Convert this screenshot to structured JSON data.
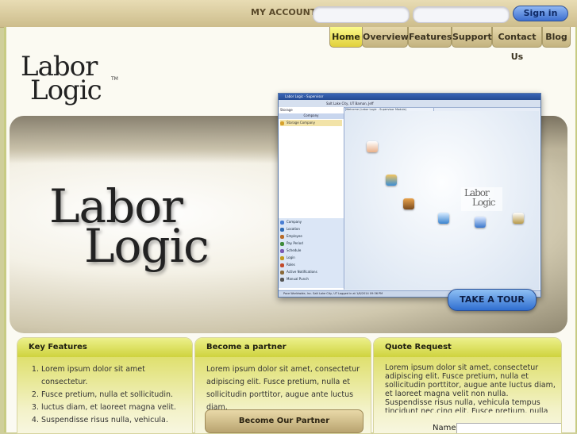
{
  "header": {
    "account_label": "MY ACCOUNT",
    "username_placeholder": "",
    "password_placeholder": "",
    "signin_label": "Sign in"
  },
  "nav": {
    "tabs": [
      {
        "label": "Home",
        "active": true
      },
      {
        "label": "Overview"
      },
      {
        "label": "Features"
      },
      {
        "label": "Support"
      },
      {
        "label": "Contact Us"
      },
      {
        "label": "Blog"
      }
    ]
  },
  "logo": {
    "line1": "Labor",
    "line2": "Logic",
    "trademark": "TM"
  },
  "hero": {
    "logo_line1": "Labor",
    "logo_line2": "Logic",
    "app_screenshot": {
      "title": "Labor Logic - Supervisor",
      "toolbar_text": "Salt Lake City, UT   Baman, Jeff",
      "left_header": "Storage",
      "company_header": "Company",
      "company_item": "Storage Company",
      "tab_text": "Welcome (Labor Logic - Supervisor Module)",
      "left_menu": [
        "Company",
        "Location",
        "Employee",
        "Pay Period",
        "Schedule",
        "Login",
        "Roles",
        "Active Notifications",
        "Manual Punch"
      ],
      "status_text": "Pace Worldwide, Inc.   Salt Lake City, UT   Logged in at 1/6/2014 09:36 PM",
      "canvas_logo_line1": "Labor",
      "canvas_logo_line2": "Logic"
    },
    "tour_label": "TAKE A TOUR"
  },
  "panels": {
    "key_features": {
      "title": "Key Features",
      "items": [
        "Lorem ipsum dolor sit amet consectetur.",
        "Fusce pretium, nulla et sollicitudin.",
        "luctus diam, et laoreet magna velit.",
        "Suspendisse risus nulla, vehicula."
      ]
    },
    "partner": {
      "title": "Become a partner",
      "text": "Lorem ipsum dolor sit amet, consectetur adipiscing elit. Fusce pretium, nulla et sollicitudin porttitor, augue ante luctus diam.",
      "button_label": "Become Our Partner"
    },
    "quote": {
      "title": "Quote Request",
      "text": "Lorem ipsum dolor sit amet, consectetur adipiscing elit. Fusce pretium, nulla et sollicitudin porttitor, augue ante luctus diam, et laoreet magna velit non nulla. Suspendisse risus nulla, vehicula tempus tincidunt nec.cing elit. Fusce pretium, nulla et sollicitudin porttitor, augue ante",
      "name_label": "Name"
    }
  },
  "colors": {
    "accent": "#e1d03c",
    "button_blue": "#3d6fd0",
    "frame": "#c7cb83"
  }
}
